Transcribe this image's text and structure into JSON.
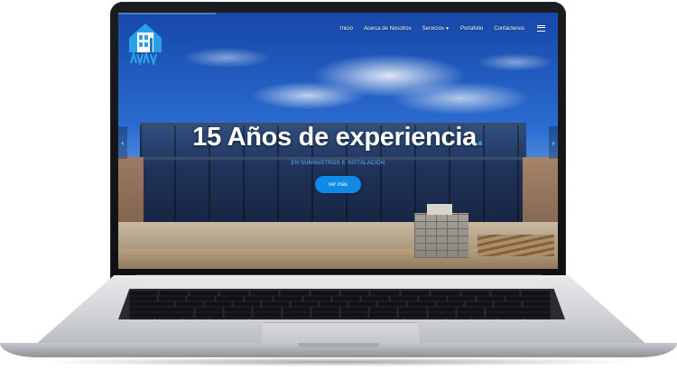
{
  "site": {
    "nav": {
      "items": [
        {
          "label": "Inicio",
          "has_caret": false
        },
        {
          "label": "Acerca de Nosotros",
          "has_caret": false
        },
        {
          "label": "Servicios",
          "has_caret": true
        },
        {
          "label": "Portafolio",
          "has_caret": false
        },
        {
          "label": "Contáctenos",
          "has_caret": false
        }
      ],
      "menu_icon": "hamburger-icon"
    },
    "hero": {
      "headline": "15 Años de experiencia",
      "headline_dot": ".",
      "subtitle": "EN SUMINISTROS E INSTALACIÓN",
      "cta_label": "ver más",
      "prev_icon": "chevron-left-icon",
      "next_icon": "chevron-right-icon"
    },
    "logo_icon": "building-logo-icon"
  },
  "colors": {
    "accent": "#0f8ae6",
    "subtitle": "#5bb4ff",
    "headline": "#ffffff"
  }
}
